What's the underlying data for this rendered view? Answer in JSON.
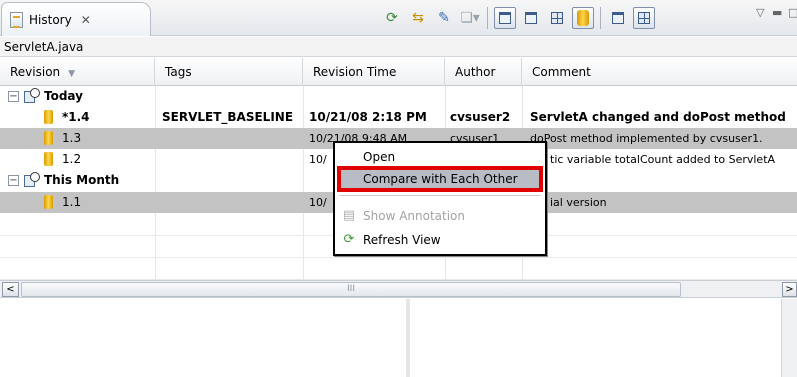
{
  "tab": {
    "title": "History",
    "close_glyph": "✕"
  },
  "file_label": "ServletA.java",
  "columns": [
    "Revision",
    "Tags",
    "Revision Time",
    "Author",
    "Comment"
  ],
  "rows": [
    {
      "type": "group",
      "label": "Today",
      "expanded": true
    },
    {
      "type": "revision",
      "revision": "*1.4",
      "tags": "SERVLET_BASELINE",
      "time": "10/21/08 2:18 PM",
      "author": "cvsuser2",
      "comment": "ServletA changed and doPost method",
      "bold": true,
      "selected": false
    },
    {
      "type": "revision",
      "revision": "1.3",
      "tags": "",
      "time": "10/21/08 9:48 AM",
      "author": "cvsuser1",
      "comment": "doPost method implemented by cvsuser1.",
      "bold": false,
      "selected": true
    },
    {
      "type": "revision",
      "revision": "1.2",
      "tags": "",
      "time": "10/",
      "author": "",
      "comment": "tic variable totalCount added to ServletA",
      "bold": false,
      "selected": false
    },
    {
      "type": "group",
      "label": "This Month",
      "expanded": true
    },
    {
      "type": "revision",
      "revision": "1.1",
      "tags": "",
      "time": "10/",
      "author": "",
      "comment": "ial version",
      "bold": false,
      "selected": true
    }
  ],
  "scrollbar": {
    "thumb_grip": "III",
    "left_arrow": "<",
    "right_arrow": ">"
  },
  "context_menu": {
    "items": [
      {
        "label": "Open",
        "enabled": true
      },
      {
        "label": "Compare with Each Other",
        "enabled": true,
        "highlighted": true
      },
      {
        "label": "Show Annotation",
        "enabled": false
      },
      {
        "label": "Refresh View",
        "enabled": true
      }
    ]
  },
  "colors": {
    "highlight_border": "#e00000",
    "selected_row": "#c3c3c3",
    "revision_icon": "#ffd84d"
  }
}
